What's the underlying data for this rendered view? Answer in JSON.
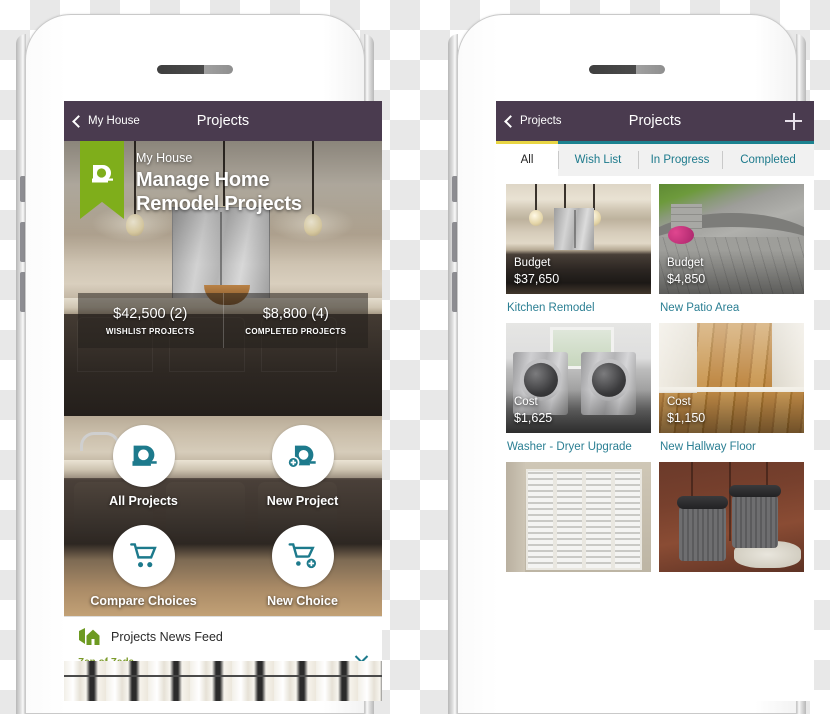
{
  "left_phone": {
    "navbar": {
      "back_label": "My House",
      "title": "Projects"
    },
    "hero": {
      "eyebrow": "My House",
      "title_line1": "Manage Home",
      "title_line2": "Remodel Projects",
      "logo_icon": "tape-measure-icon"
    },
    "stats": [
      {
        "value": "$42,500 (2)",
        "label": "WISHLIST PROJECTS"
      },
      {
        "value": "$8,800 (4)",
        "label": "COMPLETED PROJECTS"
      }
    ],
    "actions": [
      {
        "label": "All Projects",
        "icon": "tape-measure-icon"
      },
      {
        "label": "New Project",
        "icon": "tape-measure-plus-icon"
      },
      {
        "label": "Compare Choices",
        "icon": "shopping-cart-icon"
      },
      {
        "label": "New Choice",
        "icon": "shopping-cart-plus-icon"
      }
    ],
    "feed": {
      "icon": "house-flag-icon",
      "title": "Projects News Feed",
      "brand": "Zen of Zada",
      "close_icon": "close-icon"
    }
  },
  "right_phone": {
    "navbar": {
      "back_label": "Projects",
      "title": "Projects",
      "add_icon": "plus-icon"
    },
    "tabs": [
      {
        "label": "All",
        "active": true
      },
      {
        "label": "Wish List",
        "active": false
      },
      {
        "label": "In Progress",
        "active": false
      },
      {
        "label": "Completed",
        "active": false
      }
    ],
    "projects": [
      {
        "overlay_key": "Budget",
        "overlay_value": "$37,650",
        "title": "Kitchen Remodel"
      },
      {
        "overlay_key": "Budget",
        "overlay_value": "$4,850",
        "title": "New Patio Area"
      },
      {
        "overlay_key": "Cost",
        "overlay_value": "$1,625",
        "title": "Washer - Dryer Upgrade"
      },
      {
        "overlay_key": "Cost",
        "overlay_value": "$1,150",
        "title": "New Hallway Floor"
      },
      {
        "overlay_key": "",
        "overlay_value": "",
        "title": ""
      },
      {
        "overlay_key": "",
        "overlay_value": "",
        "title": ""
      }
    ]
  },
  "colors": {
    "navbar_purple": "#4a3b4f",
    "teal": "#1d7a8c",
    "green": "#7fae1b",
    "active_tab_yellow": "#e8d544",
    "tab_border_teal": "#1b8290",
    "link_teal": "#2b7f93"
  }
}
